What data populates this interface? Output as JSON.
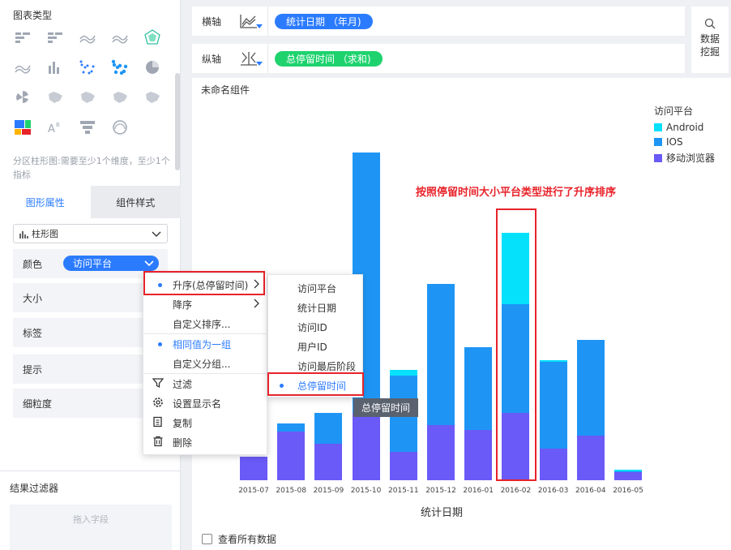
{
  "left_panel": {
    "chart_type_section_title": "图表类型",
    "chart_type_icons": [
      "bar-cross-icon",
      "bar-grouped-icon",
      "line-wave-icon",
      "area-line-icon",
      "radar-icon",
      "multi-line-icon",
      "column-icon",
      "scatter-icon",
      "bubble-icon",
      "pie-icon",
      "rose-icon",
      "china-map-icon",
      "point-map-icon",
      "flow-map-icon",
      "heat-map-icon",
      "treemap-icon",
      "word-cloud-icon",
      "funnel-icon",
      "gauge-icon"
    ],
    "hint": "分区柱形图:需要至少1个维度，至少1个指标",
    "tabs": [
      "图形属性",
      "组件样式"
    ],
    "chart_type_select": "柱形图",
    "properties": {
      "color_label": "颜色",
      "color_value": "访问平台",
      "size_label": "大小",
      "tag_label": "标签",
      "tooltip_label": "提示",
      "granularity_label": "细粒度"
    },
    "result_filter_title": "结果过滤器",
    "result_filter_placeholder": "拖入字段"
  },
  "axis": {
    "x_label": "横轴",
    "x_field": "统计日期 （年月)",
    "y_label": "纵轴",
    "y_field": "总停留时间 （求和)"
  },
  "mining_button": "数据挖掘",
  "component_title": "未命名组件",
  "annotation": "按照停留时间大小平台类型进行了升序排序",
  "view_all_data": "查看所有数据",
  "context_menu": {
    "items": [
      {
        "label": "升序(总停留时间)",
        "selected": true,
        "submenu": true
      },
      {
        "label": "降序",
        "submenu": true
      },
      {
        "label": "自定义排序..."
      },
      {
        "label": "相同值为一组",
        "selected": true
      },
      {
        "label": "自定义分组..."
      },
      {
        "label": "过滤",
        "icon": "filter-icon"
      },
      {
        "label": "设置显示名",
        "icon": "settings-icon"
      },
      {
        "label": "复制",
        "icon": "copy-icon"
      },
      {
        "label": "删除",
        "icon": "trash-icon"
      }
    ],
    "submenu_items": [
      "访问平台",
      "统计日期",
      "访问ID",
      "用户ID",
      "访问最后阶段",
      "总停留时间"
    ],
    "submenu_selected": "总停留时间",
    "tooltip": "总停留时间"
  },
  "colors": {
    "android": "#05e0fb",
    "ios": "#1e95f5",
    "mobile_browser": "#6a5af7",
    "accent": "#2b7bff",
    "green_pill": "#1ed36e",
    "highlight": "#e8232a"
  },
  "chart_data": {
    "type": "bar",
    "stacked": true,
    "xlabel": "统计日期",
    "legend_title": "访问平台",
    "categories": [
      "2015-07",
      "2015-08",
      "2015-09",
      "2015-10",
      "2015-11",
      "2015-12",
      "2016-01",
      "2016-02",
      "2016-03",
      "2016-04",
      "2016-05"
    ],
    "series": [
      {
        "name": "移动浏览器",
        "values": [
          31,
          64,
          48,
          88,
          37,
          72,
          66,
          88,
          42,
          59,
          11
        ]
      },
      {
        "name": "IOS",
        "values": [
          0,
          10,
          40,
          342,
          100,
          185,
          109,
          143,
          113,
          125,
          1
        ]
      },
      {
        "name": "Android",
        "values": [
          0,
          0,
          0,
          0,
          8,
          0,
          0,
          93,
          2,
          0,
          2
        ]
      }
    ]
  }
}
